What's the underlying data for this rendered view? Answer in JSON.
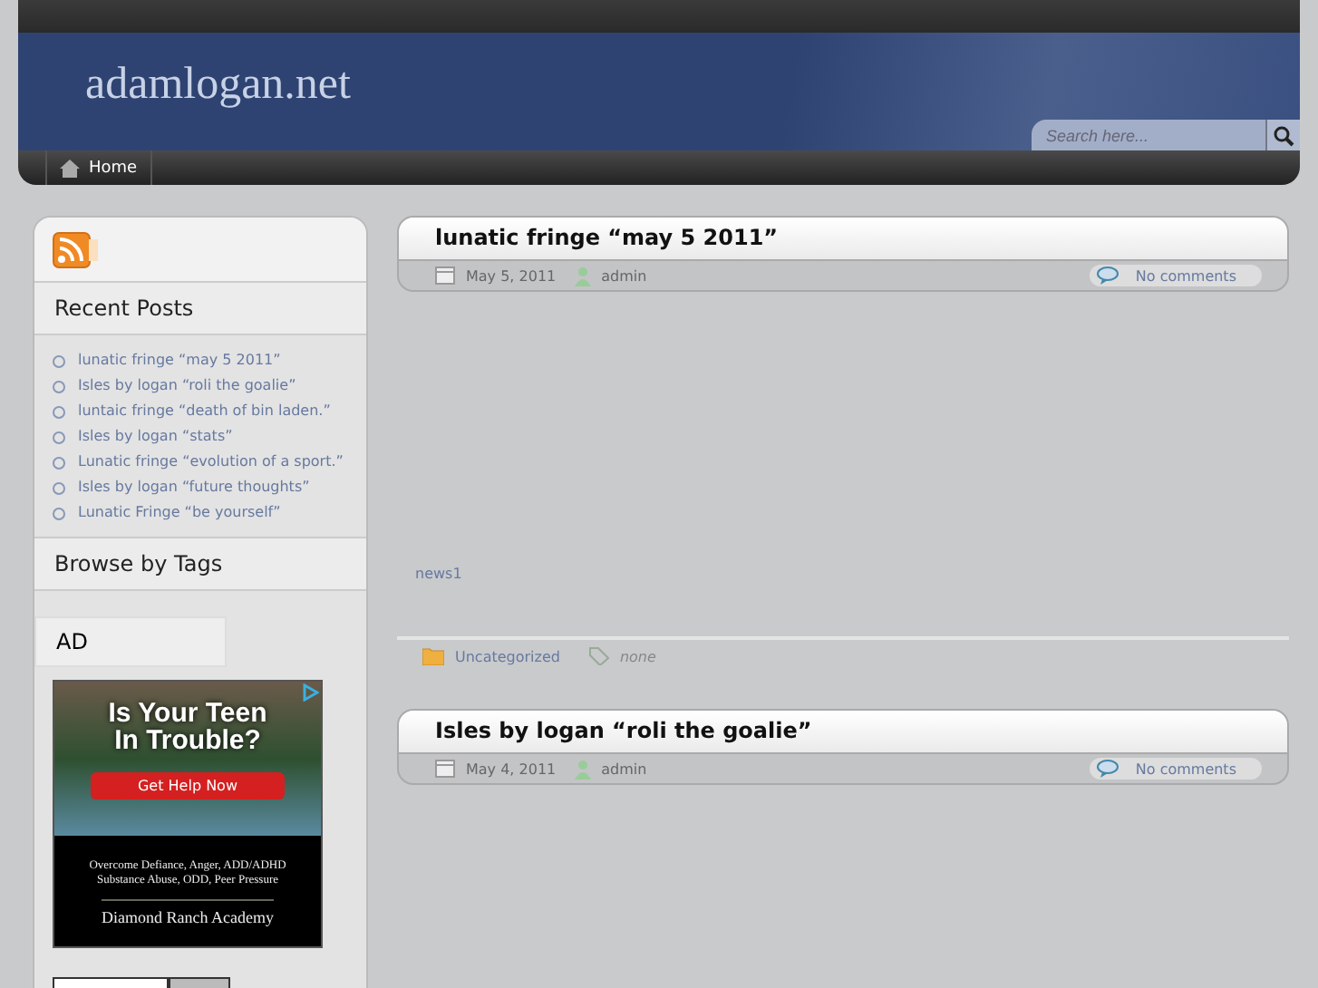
{
  "site": {
    "title": "adamlogan.net",
    "search": {
      "placeholder": "Search here..."
    }
  },
  "nav": [
    {
      "label": "Home",
      "selected": true
    }
  ],
  "sidebar": {
    "recent_title": "Recent Posts",
    "recent_posts": [
      "lunatic fringe “may 5 2011”",
      "Isles by logan “roli the goalie”",
      "luntaic fringe “death of bin laden.”",
      "Isles by logan “stats”",
      "Lunatic fringe “evolution of a sport.”",
      "Isles by logan “future thoughts”",
      "Lunatic Fringe “be yourself”"
    ],
    "tags_title": "Browse by Tags",
    "ad_title": "AD",
    "ad": {
      "headline_1": "Is Your Teen",
      "headline_2": "In Trouble?",
      "button": "Get Help Now",
      "body_1": "Overcome Defiance, Anger, ADD/ADHD",
      "body_2": "Substance Abuse, ODD, Peer Pressure",
      "brand": "Diamond Ranch Academy"
    }
  },
  "posts": [
    {
      "title": "lunatic fringe “may 5 2011”",
      "date": "May 5, 2011",
      "author": "admin",
      "comments": "No comments",
      "body": "news1",
      "category": "Uncategorized",
      "tags": "none"
    },
    {
      "title": "Isles by logan “roli the goalie”",
      "date": "May 4, 2011",
      "author": "admin",
      "comments": "No comments"
    }
  ]
}
